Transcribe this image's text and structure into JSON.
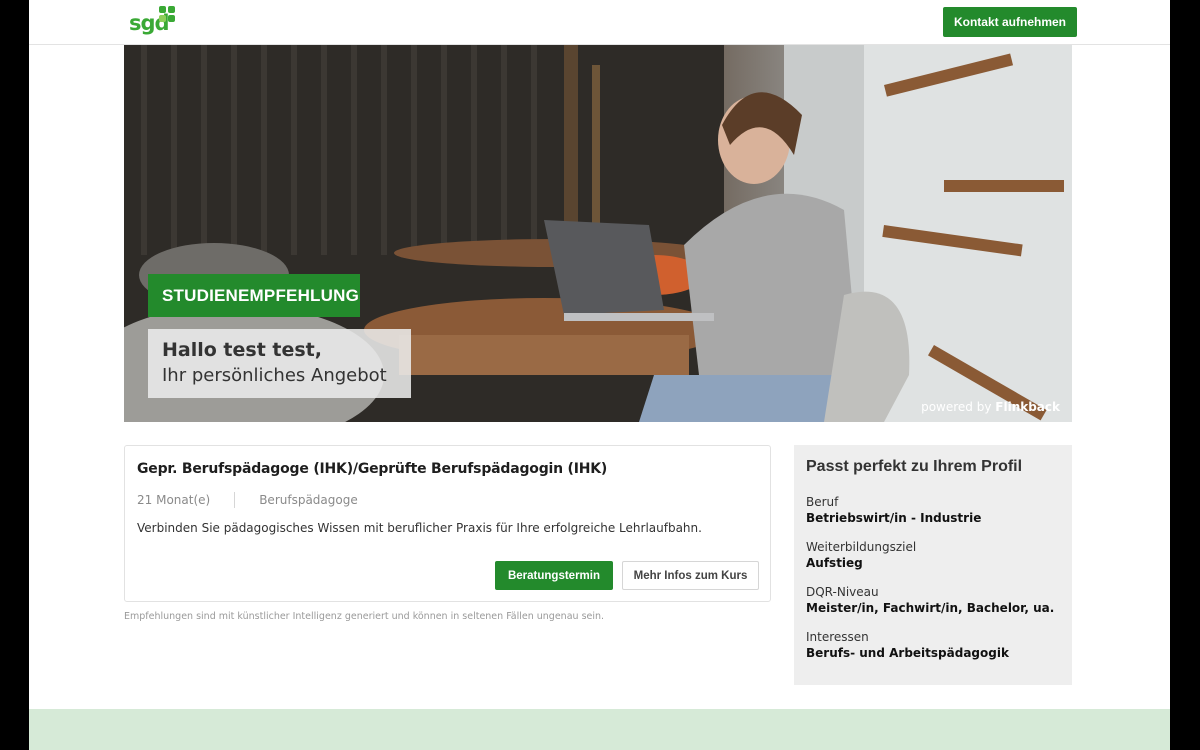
{
  "header": {
    "logo_text": "sgd",
    "contact_label": "Kontakt aufnehmen",
    "brand_color": "#3aa935",
    "button_color": "#238a2c"
  },
  "hero": {
    "badge": "STUDIENEMPFEHLUNG",
    "greeting_line1": "Hallo test test,",
    "greeting_line2": "Ihr persönliches Angebot",
    "powered_prefix": "powered by ",
    "powered_brand": "Flinkback"
  },
  "course": {
    "title": "Gepr. Berufspädagoge (IHK)/Geprüfte Berufspädagogin (IHK)",
    "duration": "21 Monat(e)",
    "category": "Berufspädagoge",
    "description": "Verbinden Sie pädagogisches Wissen mit beruflicher Praxis für Ihre erfolgreiche Lehrlaufbahn.",
    "primary_button": "Beratungstermin",
    "secondary_button": "Mehr Infos zum Kurs"
  },
  "disclaimer": "Empfehlungen sind mit künstlicher Intelligenz generiert und können in seltenen Fällen ungenau sein.",
  "profile": {
    "title": "Passt perfekt zu Ihrem Profil",
    "items": [
      {
        "label": "Beruf",
        "value": "Betriebswirt/in - Industrie"
      },
      {
        "label": "Weiterbildungsziel",
        "value": "Aufstieg"
      },
      {
        "label": "DQR-Niveau",
        "value": "Meister/in, Fachwirt/in, Bachelor, ua."
      },
      {
        "label": "Interessen",
        "value": "Berufs- und Arbeitspädagogik"
      }
    ]
  }
}
